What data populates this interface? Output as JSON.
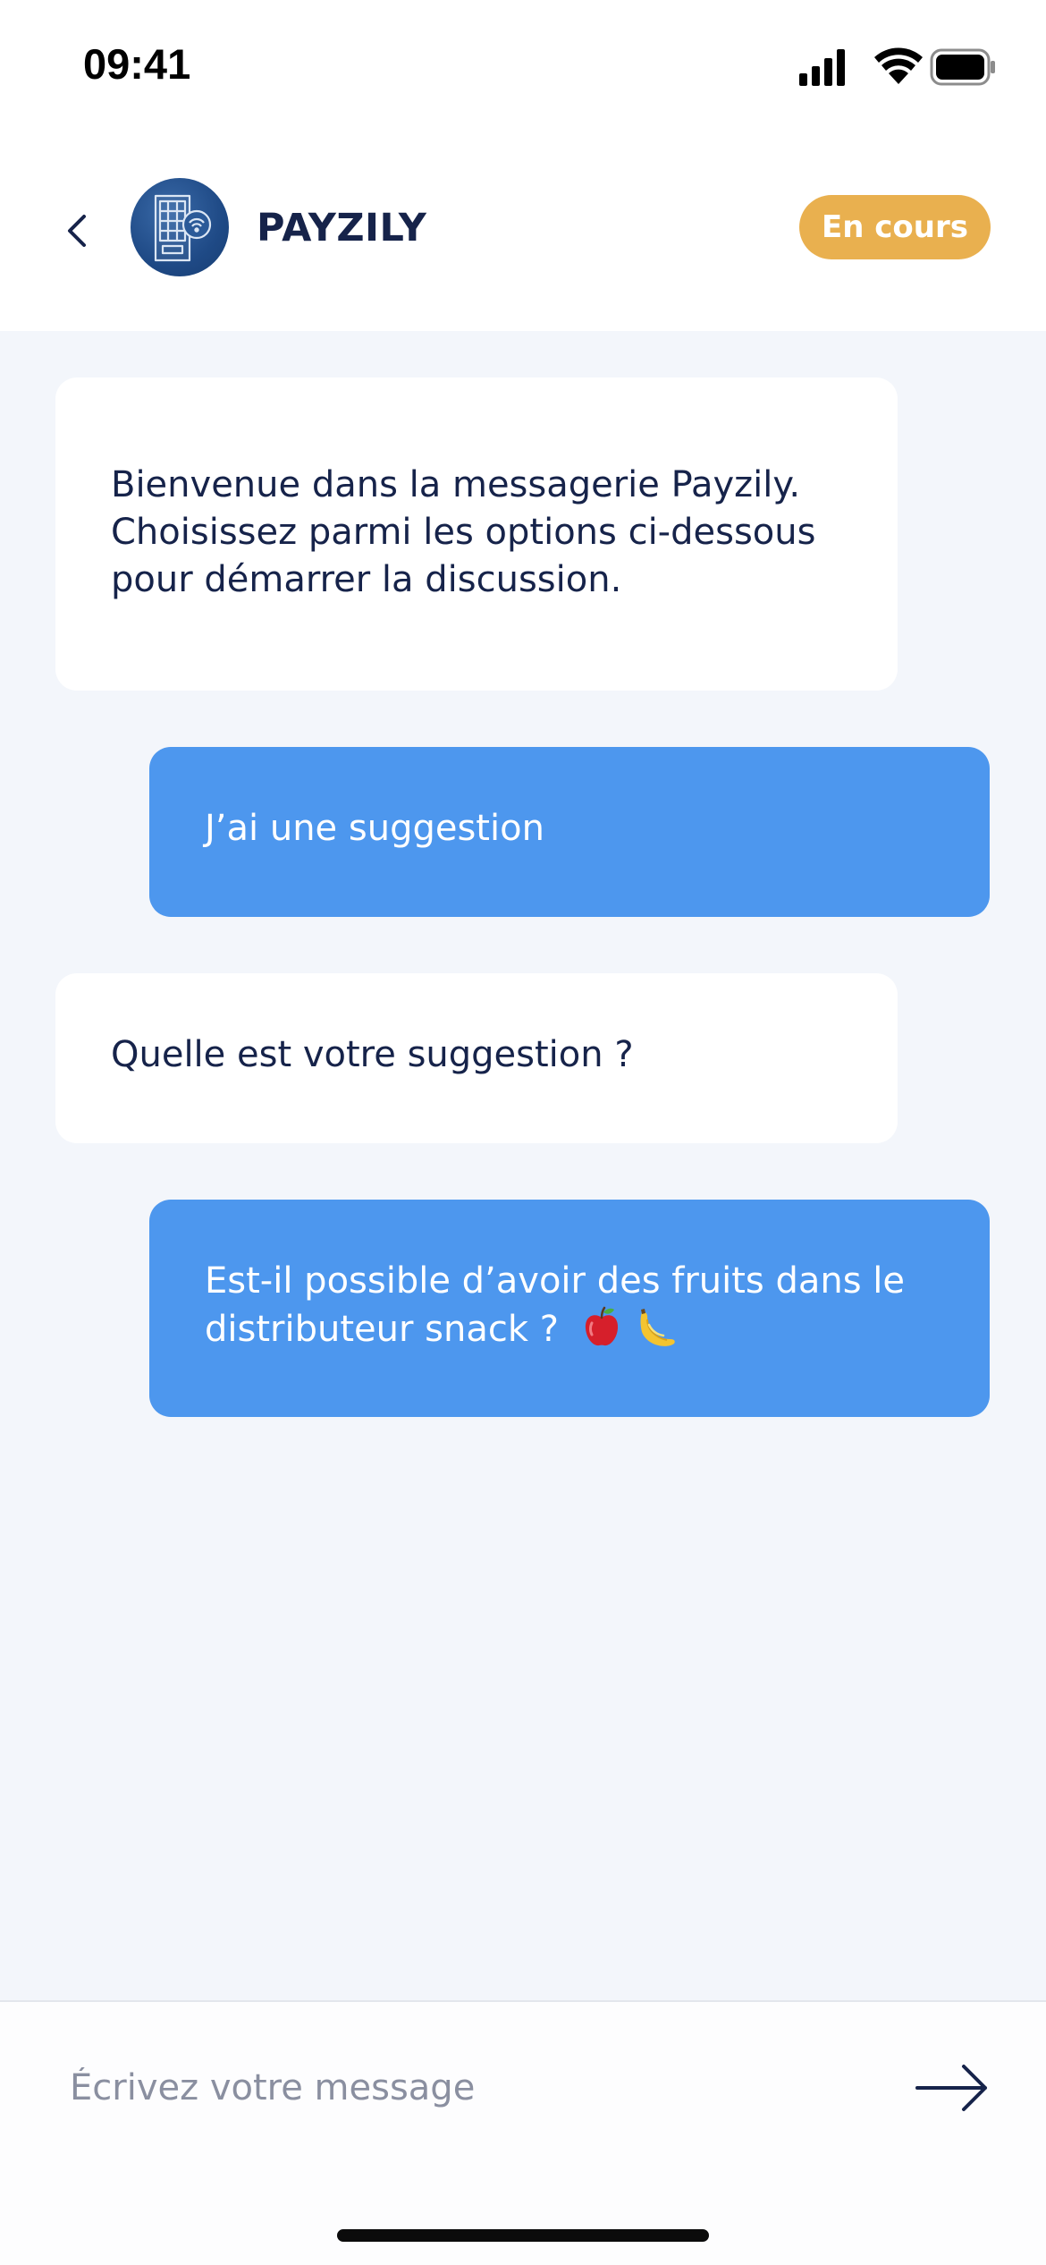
{
  "status_bar": {
    "time": "09:41",
    "icons": [
      "cellular-signal-icon",
      "wifi-icon",
      "battery-icon"
    ]
  },
  "header": {
    "back_icon": "chevron-left-icon",
    "avatar_icon": "vending-machine-icon",
    "title": "PAYZILY",
    "status_badge": "En cours"
  },
  "messages": [
    {
      "sender": "bot",
      "text": "Bienvenue dans la messagerie Payzily. Choisissez parmi les options ci-dessous pour démarrer la discussion."
    },
    {
      "sender": "user",
      "text": "J’ai une suggestion"
    },
    {
      "sender": "bot",
      "text": "Quelle est votre suggestion ?"
    },
    {
      "sender": "user",
      "text": "Est-il possible d’avoir des fruits dans le distributeur snack ?",
      "emojis": [
        "apple-emoji",
        "banana-emoji"
      ]
    }
  ],
  "composer": {
    "placeholder": "Écrivez votre message",
    "value": "",
    "send_icon": "arrow-right-icon"
  },
  "colors": {
    "header_text": "#16234a",
    "badge": "#e9b04f",
    "user_bubble": "#4d97ee",
    "bot_bubble": "#ffffff",
    "chat_background": "#f3f6fb",
    "avatar": "#1f4a86"
  }
}
